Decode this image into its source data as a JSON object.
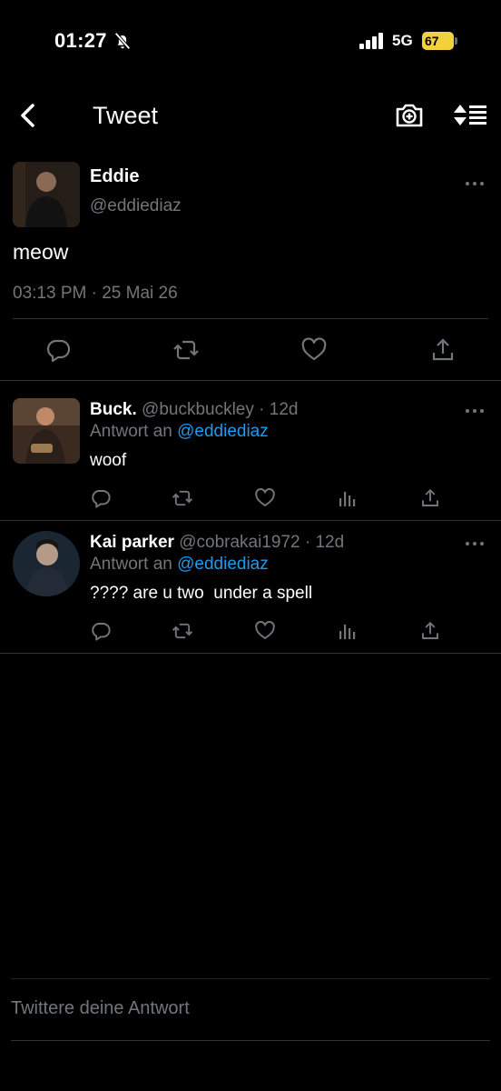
{
  "status_bar": {
    "time": "01:27",
    "network": "5G",
    "battery": "67"
  },
  "header": {
    "title": "Tweet"
  },
  "main_tweet": {
    "name": "Eddie",
    "handle": "@eddiediaz",
    "text": "meow",
    "timestamp": "03:13 PM · 25 Mai 26"
  },
  "replies": [
    {
      "name": "Buck.",
      "handle": "@buckbuckley · 12d",
      "reply_prefix": "Antwort an",
      "reply_to": "@eddiediaz",
      "text": "woof"
    },
    {
      "name": "Kai parker",
      "handle": "@cobrakai1972 · 12d",
      "reply_prefix": "Antwort an",
      "reply_to": "@eddiediaz",
      "text": "???? are u two  under a spell"
    }
  ],
  "composer": {
    "placeholder": "Twittere deine Antwort"
  },
  "colors": {
    "background": "#000000",
    "text_primary": "#e7e9ea",
    "text_secondary": "#71767b",
    "accent": "#1d9bf0",
    "divider": "#2f3336",
    "battery": "#f3d03d"
  },
  "icons": [
    "bell-off-icon",
    "signal-icon",
    "battery-icon",
    "back-arrow-icon",
    "camera-plus-icon",
    "sort-icon",
    "more-icon",
    "reply-icon",
    "retweet-icon",
    "like-icon",
    "views-icon",
    "share-icon"
  ]
}
